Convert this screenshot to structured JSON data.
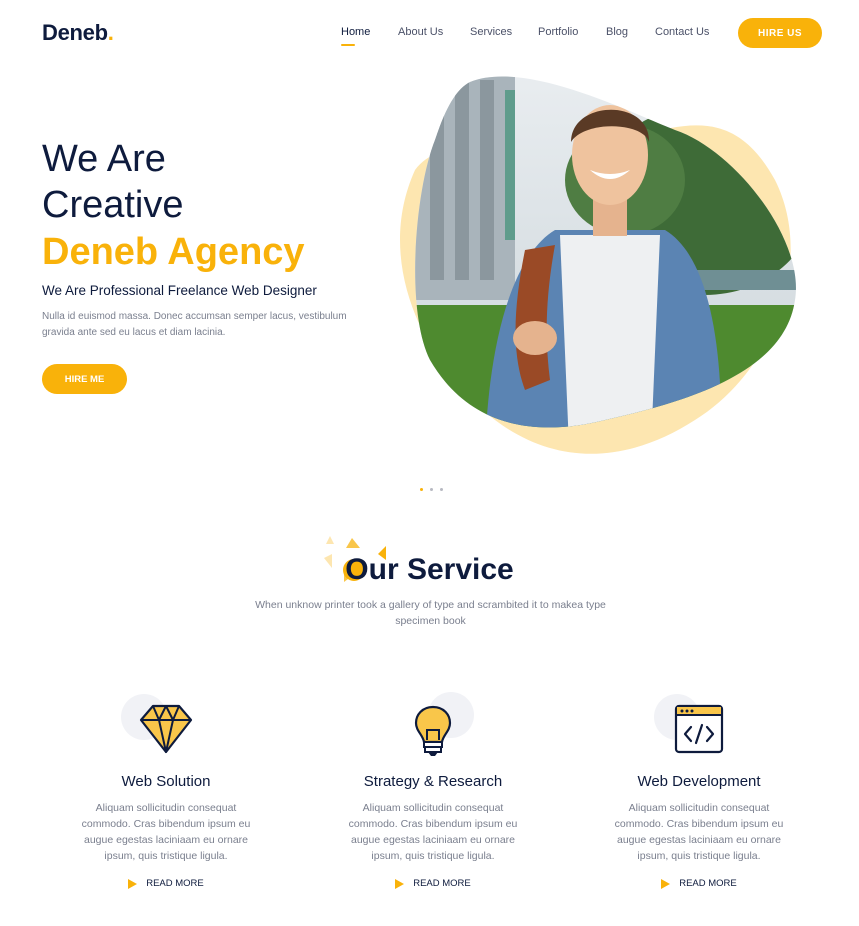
{
  "header": {
    "logo": "Deneb",
    "logo_dot": ".",
    "nav": [
      "Home",
      "About Us",
      "Services",
      "Portfolio",
      "Blog",
      "Contact Us"
    ],
    "active_nav": "Home",
    "cta": "HIRE US"
  },
  "hero": {
    "line1": "We Are",
    "line2": "Creative",
    "line3": "Deneb Agency",
    "subtitle": "We Are Professional Freelance Web Designer",
    "description": "Nulla id euismod massa. Donec accumsan semper lacus, vestibulum gravida ante sed eu lacus et diam lacinia.",
    "cta": "HIRE ME",
    "image": "smiling-man-denim-jacket-photo"
  },
  "slider": {
    "count": 3,
    "active": 1
  },
  "services": {
    "title": "Our Service",
    "subtitle": "When unknow printer took a gallery of type and scrambited it to makea type specimen book",
    "items": [
      {
        "icon": "diamond-icon",
        "title": "Web Solution",
        "text": "Aliquam sollicitudin consequat commodo. Cras bibendum ipsum eu augue egestas laciniaam eu ornare ipsum, quis tristique ligula.",
        "link": "READ MORE"
      },
      {
        "icon": "lightbulb-icon",
        "title": "Strategy & Research",
        "text": "Aliquam sollicitudin consequat commodo. Cras bibendum ipsum eu augue egestas laciniaam eu ornare ipsum, quis tristique ligula.",
        "link": "READ MORE"
      },
      {
        "icon": "code-browser-icon",
        "title": "Web Development",
        "text": "Aliquam sollicitudin consequat commodo. Cras bibendum ipsum eu augue egestas laciniaam eu ornare ipsum, quis tristique ligula.",
        "link": "READ MORE"
      }
    ]
  },
  "colors": {
    "accent": "#f9b20a",
    "navy": "#0e1b3d",
    "muted": "#7a7f8e",
    "blob": "#fde6b0"
  }
}
